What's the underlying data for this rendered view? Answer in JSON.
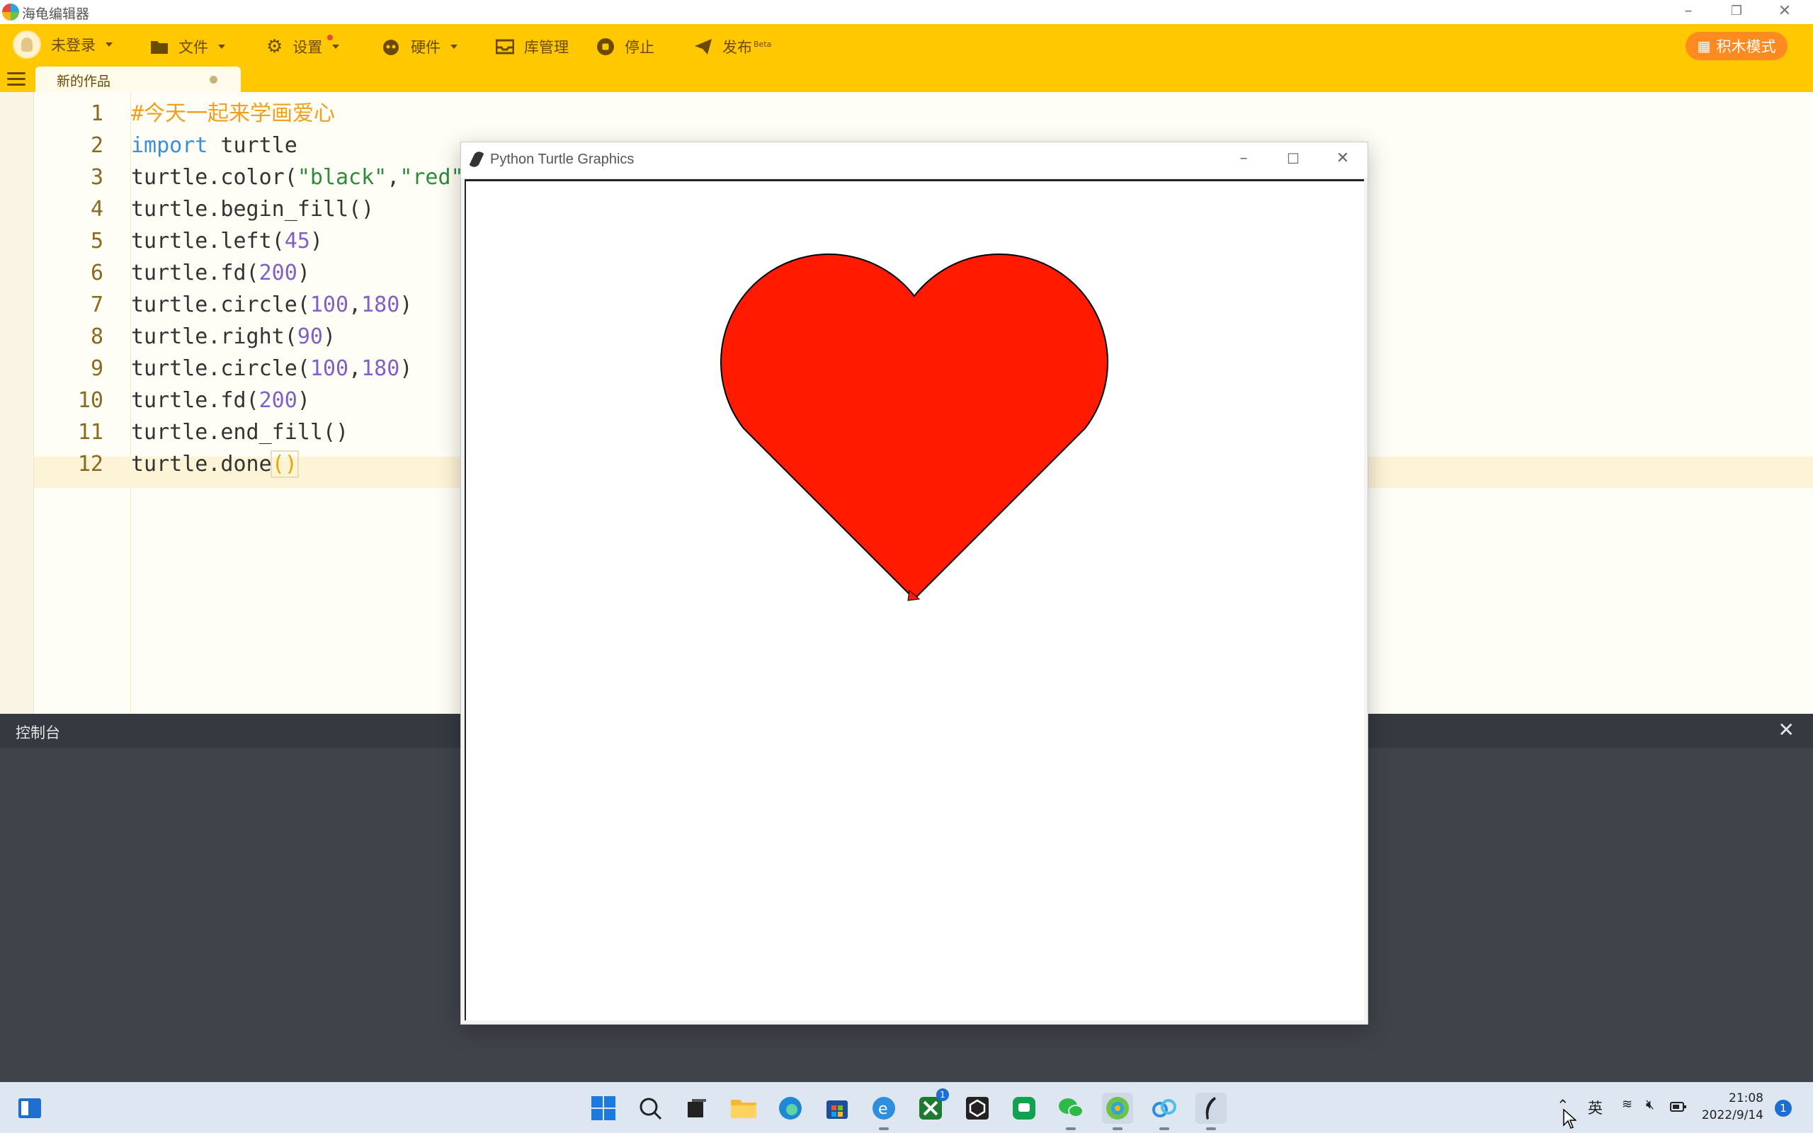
{
  "app": {
    "title": "海龟编辑器"
  },
  "toolbar": {
    "login": "未登录",
    "file": "文件",
    "settings": "设置",
    "hardware": "硬件",
    "library": "库管理",
    "stop": "停止",
    "publish": "发布",
    "publish_badge": "Beta",
    "block_mode": "积木模式"
  },
  "tab": {
    "label": "新的作品"
  },
  "editor": {
    "lines": [
      "1",
      "2",
      "3",
      "4",
      "5",
      "6",
      "7",
      "8",
      "9",
      "10",
      "11",
      "12"
    ],
    "code": {
      "l1": "#今天一起来学画爱心",
      "l2_kw": "import",
      "l2_rest": " turtle",
      "l3_a": "turtle.color(",
      "l3_s1": "\"black\"",
      "l3_b": ",",
      "l3_s2": "\"red\"",
      "l4": "turtle.begin_fill()",
      "l5_a": "turtle.left(",
      "l5_n": "45",
      "l5_b": ")",
      "l6_a": "turtle.fd(",
      "l6_n": "200",
      "l6_b": ")",
      "l7_a": "turtle.circle(",
      "l7_n1": "100",
      "l7_c": ",",
      "l7_n2": "180",
      "l7_b": ")",
      "l8_a": "turtle.right(",
      "l8_n": "90",
      "l8_b": ")",
      "l9_a": "turtle.circle(",
      "l9_n1": "100",
      "l9_c": ",",
      "l9_n2": "180",
      "l9_b": ")",
      "l10_a": "turtle.fd(",
      "l10_n": "200",
      "l10_b": ")",
      "l11": "turtle.end_fill()",
      "l12_a": "turtle.done",
      "l12_p": "()"
    },
    "stop_button": "停止"
  },
  "console": {
    "title": "控制台"
  },
  "turtle_window": {
    "title": "Python Turtle Graphics",
    "pen_color": "#000000",
    "fill_color": "#ff1a00"
  },
  "taskbar": {
    "ime": "英",
    "time": "21:08",
    "date": "2022/9/14",
    "xbox_badge": "1",
    "notifications": "1"
  }
}
